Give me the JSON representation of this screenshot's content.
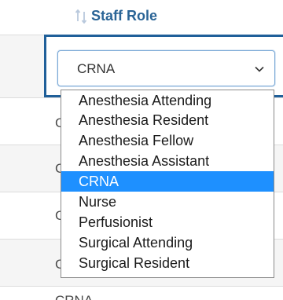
{
  "header": {
    "title": "Staff Role",
    "sort_icon": "sort-arrows-icon"
  },
  "table": {
    "row_peek_label": "C",
    "bottom_row_value": "CRNA"
  },
  "editor": {
    "selected_value": "CRNA",
    "chevron_icon": "chevron-down-icon",
    "options": [
      {
        "label": "Anesthesia Attending",
        "selected": false
      },
      {
        "label": "Anesthesia Resident",
        "selected": false
      },
      {
        "label": "Anesthesia Fellow",
        "selected": false
      },
      {
        "label": "Anesthesia Assistant",
        "selected": false
      },
      {
        "label": "CRNA",
        "selected": true
      },
      {
        "label": "Nurse",
        "selected": false
      },
      {
        "label": "Perfusionist",
        "selected": false
      },
      {
        "label": "Surgical Attending",
        "selected": false
      },
      {
        "label": "Surgical Resident",
        "selected": false
      }
    ]
  },
  "colors": {
    "header_text": "#2a6496",
    "selection": "#1e90ff",
    "edit_border": "#1f5f99"
  }
}
